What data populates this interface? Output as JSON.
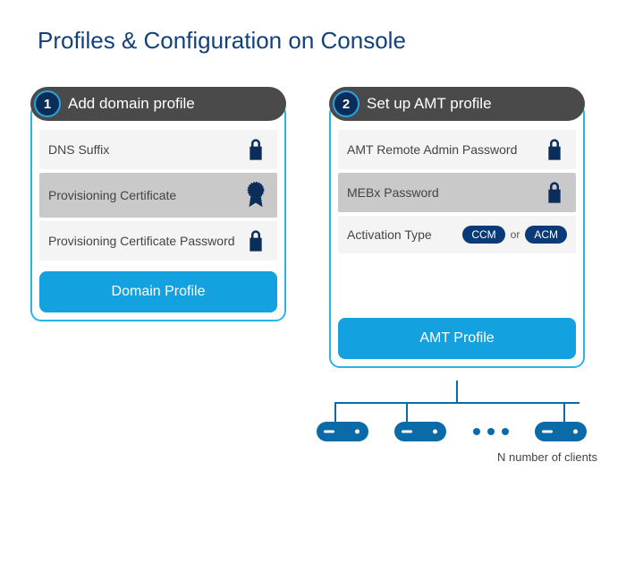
{
  "title": "Profiles & Configuration on Console",
  "step1": {
    "number": "1",
    "header": "Add domain profile",
    "rows": {
      "dns": "DNS Suffix",
      "cert": "Provisioning Certificate",
      "certpw": "Provisioning Certificate Password"
    },
    "footer": "Domain Profile"
  },
  "step2": {
    "number": "2",
    "header": "Set up AMT profile",
    "rows": {
      "adminpw": "AMT Remote Admin Password",
      "mebx": "MEBx Password",
      "activation_label": "Activation Type",
      "ccm": "CCM",
      "or": "or",
      "acm": "ACM"
    },
    "footer": "AMT Profile",
    "clients_caption": "N number of clients"
  }
}
